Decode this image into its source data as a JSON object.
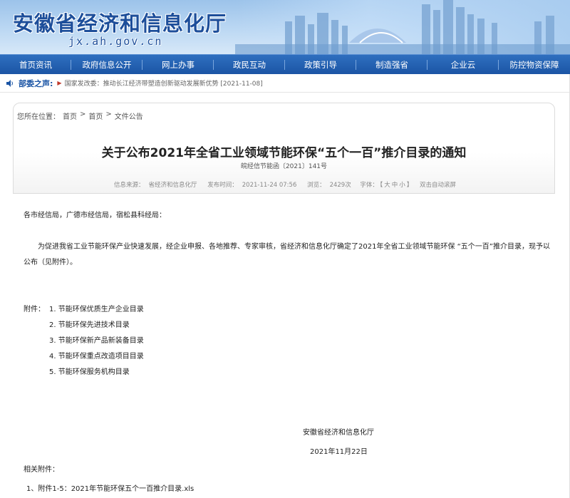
{
  "header": {
    "site_title": "安徽省经济和信息化厅",
    "site_domain": "jx.ah.gov.cn"
  },
  "nav": {
    "items": [
      "首页资讯",
      "政府信息公开",
      "网上办事",
      "政民互动",
      "政策引导",
      "制造强省",
      "企业云",
      "防控物资保障"
    ]
  },
  "ticker": {
    "label": "部委之声:",
    "text": "国家发改委：推动长江经济带塑造创新驱动发展新优势 [2021-11-08]"
  },
  "breadcrumb": {
    "prefix": "您所在位置：",
    "items": [
      "首页",
      "首页",
      "文件公告"
    ],
    "separator": ">"
  },
  "article": {
    "title": "关于公布2021年全省工业领域节能环保“五个一百”推介目录的通知",
    "doc_number": "皖经信节能函〔2021〕141号",
    "meta": {
      "source_label": "信息来源：",
      "source": "省经济和信息化厅",
      "time_label": "发布时间：",
      "time": "2021-11-24 07:56",
      "views_label": "浏览：",
      "views": "2429次",
      "font_label": "字体：",
      "font_open": "【",
      "font_large": "大",
      "font_medium": "中",
      "font_small": "小",
      "font_close": "】",
      "auto_scroll": "双击自动滚屏"
    },
    "greeting": "各市经信局，广德市经信局，宿松县科经局：",
    "body": "为促进我省工业节能环保产业快速发展，经企业申报、各地推荐、专家审核，省经济和信息化厅确定了2021年全省工业领域节能环保 “五个一百”推介目录，现予以公布（见附件）。",
    "attachments_label": "附件：",
    "attachments": [
      "1. 节能环保优质生产企业目录",
      "2. 节能环保先进技术目录",
      "3. 节能环保新产品新装备目录",
      "4. 节能环保重点改造项目目录",
      "5. 节能环保服务机构目录"
    ],
    "signature_org": "安徽省经济和信息化厅",
    "signature_date": "2021年11月22日",
    "related_title": "相关附件：",
    "related_file": "1、附件1-5：2021年节能环保五个一百推介目录.xls"
  },
  "colors": {
    "nav_bg": "#1b55a5",
    "title_blue": "#1d4e9a"
  }
}
